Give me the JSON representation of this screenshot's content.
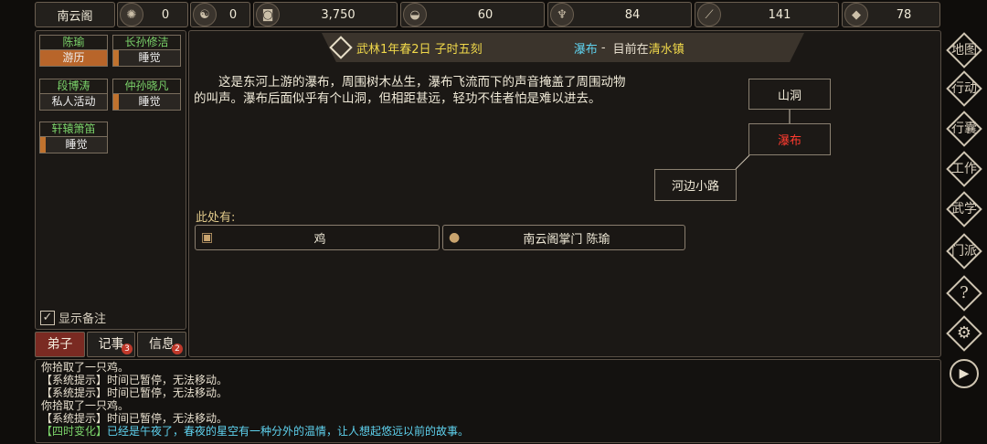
{
  "topbar": {
    "sect_name": "南云阁",
    "stat1": {
      "icon": "coin-purse-icon",
      "value": "0"
    },
    "stat2": {
      "icon": "yin-yang-icon",
      "value": "0"
    },
    "stat3": {
      "icon": "copper-coin-icon",
      "value": "3,750"
    },
    "stat4": {
      "icon": "food-bowl-icon",
      "value": "60"
    },
    "stat5": {
      "icon": "herb-icon",
      "value": "84"
    },
    "stat6": {
      "icon": "wood-icon",
      "value": "141"
    },
    "stat7": {
      "icon": "ore-icon",
      "value": "78"
    }
  },
  "disciples": [
    {
      "name": "陈瑜",
      "status": "游历"
    },
    {
      "name": "长孙修洁",
      "status": "睡觉"
    },
    {
      "name": "段博涛",
      "status": "私人活动"
    },
    {
      "name": "仲孙晓凡",
      "status": "睡觉"
    },
    {
      "name": "轩辕箫笛",
      "status": "睡觉"
    }
  ],
  "show_notes": "显示备注",
  "tabs": {
    "disciples": "弟子",
    "records": "记事",
    "records_badge": "3",
    "info": "信息",
    "info_badge": "2"
  },
  "location": {
    "date": "武林1年春2日 子时五刻",
    "place": "瀑布",
    "sep": " - ",
    "current_prefix": "目前在",
    "town": "清水镇",
    "description": "这是东河上游的瀑布，周围树木丛生，瀑布飞流而下的声音掩盖了周围动物的叫声。瀑布后面似乎有个山洞，但相距甚远，轻功不佳者怕是难以进去。",
    "here_label": "此处有:",
    "items": [
      {
        "icon": "item-bag-icon",
        "label": "鸡"
      },
      {
        "icon": "person-icon",
        "label": "南云阁掌门 陈瑜"
      }
    ]
  },
  "map_nodes": {
    "cave": "山洞",
    "waterfall": "瀑布",
    "road": "河边小路"
  },
  "side_menu": [
    "地图",
    "行动",
    "行囊",
    "工作",
    "武学",
    "门派"
  ],
  "log": [
    {
      "text": "你拾取了一只鸡。"
    },
    {
      "text": "【系统提示】时间已暂停，无法移动。"
    },
    {
      "text": "【系统提示】时间已暂停，无法移动。"
    },
    {
      "text": "你拾取了一只鸡。"
    },
    {
      "text": "【系统提示】时间已暂停，无法移动。"
    },
    {
      "tag": "【四时变化】",
      "text": "已经是午夜了，春夜的星空有一种分外的温情，让人想起悠远以前的故事。"
    }
  ],
  "colors": {
    "accent_green": "#7bd36a",
    "accent_yellow": "#f0d84a",
    "accent_cyan": "#5fd3f0",
    "current_red": "#ff3b2f",
    "status_orange": "#b8652a"
  }
}
